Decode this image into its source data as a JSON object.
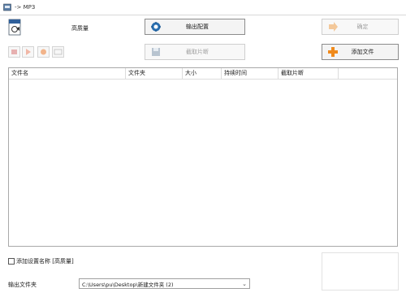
{
  "window": {
    "title": "-> MP3"
  },
  "profile": {
    "quality_label": "高质量"
  },
  "buttons": {
    "output_config": "输出配置",
    "clip": "截取片断",
    "confirm": "确定",
    "add_file": "添加文件"
  },
  "table": {
    "columns": [
      "文件名",
      "文件夹",
      "大小",
      "持续时间",
      "截取片断"
    ]
  },
  "options": {
    "add_setting_name": "添加设置名称 [高质量]"
  },
  "output": {
    "label": "输出文件夹",
    "folder": "C:\\Users\\pu\\Desktop\\新建文件夹 (2)"
  },
  "colors": {
    "add_accent": "#f08a1c",
    "config_accent": "#2a6fb0"
  }
}
